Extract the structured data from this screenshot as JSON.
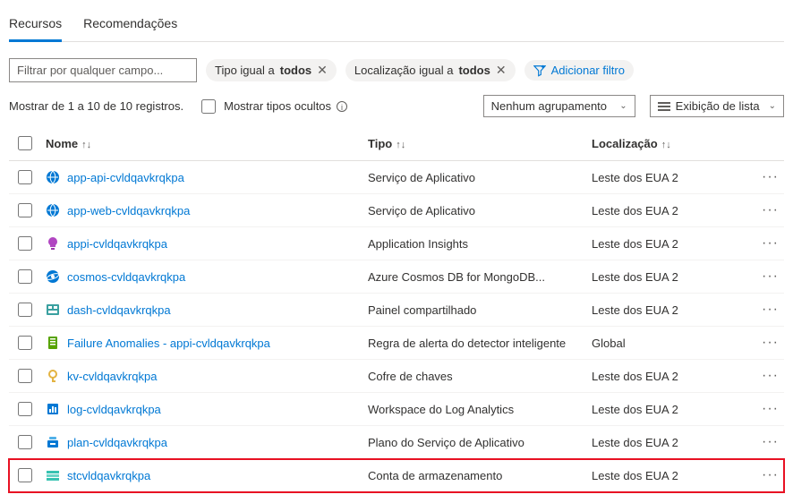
{
  "tabs": {
    "resources": "Recursos",
    "recommendations": "Recomendações"
  },
  "filter": {
    "placeholder": "Filtrar por qualquer campo..."
  },
  "pills": {
    "type_prefix": "Tipo igual a ",
    "type_value": "todos",
    "location_prefix": "Localização igual a ",
    "location_value": "todos",
    "add_filter": "Adicionar filtro"
  },
  "controls": {
    "record_count": "Mostrar de 1 a 10 de 10 registros.",
    "show_hidden_types": "Mostrar tipos ocultos",
    "grouping": "Nenhum agrupamento",
    "view": "Exibição de lista"
  },
  "columns": {
    "name": "Nome",
    "type": "Tipo",
    "location": "Localização"
  },
  "rows": [
    {
      "icon": "appservice",
      "name": "app-api-cvldqavkrqkpa",
      "type": "Serviço de Aplicativo",
      "location": "Leste dos EUA 2",
      "highlighted": false
    },
    {
      "icon": "appservice",
      "name": "app-web-cvldqavkrqkpa",
      "type": "Serviço de Aplicativo",
      "location": "Leste dos EUA 2",
      "highlighted": false
    },
    {
      "icon": "appinsights",
      "name": "appi-cvldqavkrqkpa",
      "type": "Application Insights",
      "location": "Leste dos EUA 2",
      "highlighted": false
    },
    {
      "icon": "cosmos",
      "name": "cosmos-cvldqavkrqkpa",
      "type": "Azure Cosmos DB for MongoDB...",
      "location": "Leste dos EUA 2",
      "highlighted": false
    },
    {
      "icon": "dashboard",
      "name": "dash-cvldqavkrqkpa",
      "type": "Painel compartilhado",
      "location": "Leste dos EUA 2",
      "highlighted": false
    },
    {
      "icon": "alert",
      "name": "Failure Anomalies - appi-cvldqavkrqkpa",
      "type": "Regra de alerta do detector inteligente",
      "location": "Global",
      "highlighted": false
    },
    {
      "icon": "keyvault",
      "name": "kv-cvldqavkrqkpa",
      "type": "Cofre de chaves",
      "location": "Leste dos EUA 2",
      "highlighted": false
    },
    {
      "icon": "loganalytics",
      "name": "log-cvldqavkrqkpa",
      "type": "Workspace do Log Analytics",
      "location": "Leste dos EUA 2",
      "highlighted": false
    },
    {
      "icon": "plan",
      "name": "plan-cvldqavkrqkpa",
      "type": "Plano do Serviço de Aplicativo",
      "location": "Leste dos EUA 2",
      "highlighted": false
    },
    {
      "icon": "storage",
      "name": "stcvldqavkrqkpa",
      "type": "Conta de armazenamento",
      "location": "Leste dos EUA 2",
      "highlighted": true
    }
  ]
}
